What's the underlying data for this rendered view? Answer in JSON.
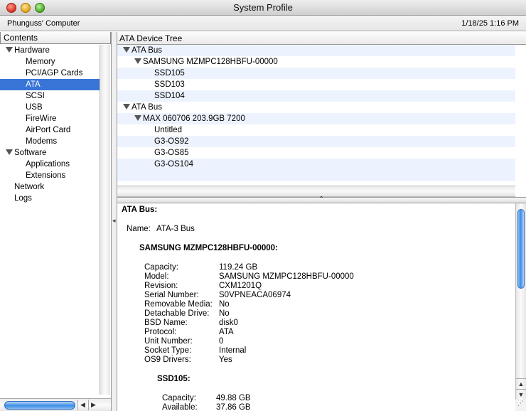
{
  "window": {
    "title": "System Profile"
  },
  "infobar": {
    "computer_name": "Phunguss' Computer",
    "datetime": "1/18/25 1:16 PM"
  },
  "sidebar": {
    "header": "Contents",
    "items": [
      {
        "label": "Hardware",
        "level": 0,
        "expanded": true
      },
      {
        "label": "Memory",
        "level": 1
      },
      {
        "label": "PCI/AGP Cards",
        "level": 1
      },
      {
        "label": "ATA",
        "level": 1,
        "selected": true
      },
      {
        "label": "SCSI",
        "level": 1
      },
      {
        "label": "USB",
        "level": 1
      },
      {
        "label": "FireWire",
        "level": 1
      },
      {
        "label": "AirPort Card",
        "level": 1
      },
      {
        "label": "Modems",
        "level": 1
      },
      {
        "label": "Software",
        "level": 0,
        "expanded": true
      },
      {
        "label": "Applications",
        "level": 1
      },
      {
        "label": "Extensions",
        "level": 1
      },
      {
        "label": "Network",
        "level": 0
      },
      {
        "label": "Logs",
        "level": 0
      }
    ]
  },
  "device_tree": {
    "header": "ATA Device Tree",
    "rows": [
      {
        "label": "ATA Bus",
        "level": 0,
        "expanded": true
      },
      {
        "label": "SAMSUNG MZMPC128HBFU-00000",
        "level": 1,
        "expanded": true
      },
      {
        "label": "SSD105",
        "level": 2
      },
      {
        "label": "SSD103",
        "level": 2
      },
      {
        "label": "SSD104",
        "level": 2
      },
      {
        "label": "ATA Bus",
        "level": 0,
        "expanded": true
      },
      {
        "label": "MAX 060706 203.9GB 7200",
        "level": 1,
        "expanded": true
      },
      {
        "label": "Untitled",
        "level": 2
      },
      {
        "label": "G3-OS92",
        "level": 2
      },
      {
        "label": "G3-OS85",
        "level": 2
      },
      {
        "label": "G3-OS104",
        "level": 2
      }
    ]
  },
  "details": {
    "bus_heading": "ATA Bus:",
    "name_label": "Name:",
    "name_value": "ATA-3 Bus",
    "drive_heading": "SAMSUNG MZMPC128HBFU-00000:",
    "drive_fields": [
      {
        "label": "Capacity:",
        "value": "119.24 GB"
      },
      {
        "label": "Model:",
        "value": "SAMSUNG MZMPC128HBFU-00000"
      },
      {
        "label": "Revision:",
        "value": "CXM1201Q"
      },
      {
        "label": "Serial Number:",
        "value": "S0VPNEACA06974"
      },
      {
        "label": "Removable Media:",
        "value": "No"
      },
      {
        "label": "Detachable Drive:",
        "value": "No"
      },
      {
        "label": "BSD Name:",
        "value": "disk0"
      },
      {
        "label": "Protocol:",
        "value": "ATA"
      },
      {
        "label": "Unit Number:",
        "value": "0"
      },
      {
        "label": "Socket Type:",
        "value": "Internal"
      },
      {
        "label": "OS9 Drivers:",
        "value": "Yes"
      }
    ],
    "volume_heading": "SSD105:",
    "volume_fields": [
      {
        "label": "Capacity:",
        "value": "49.88 GB"
      },
      {
        "label": "Available:",
        "value": "37.86 GB"
      }
    ]
  }
}
